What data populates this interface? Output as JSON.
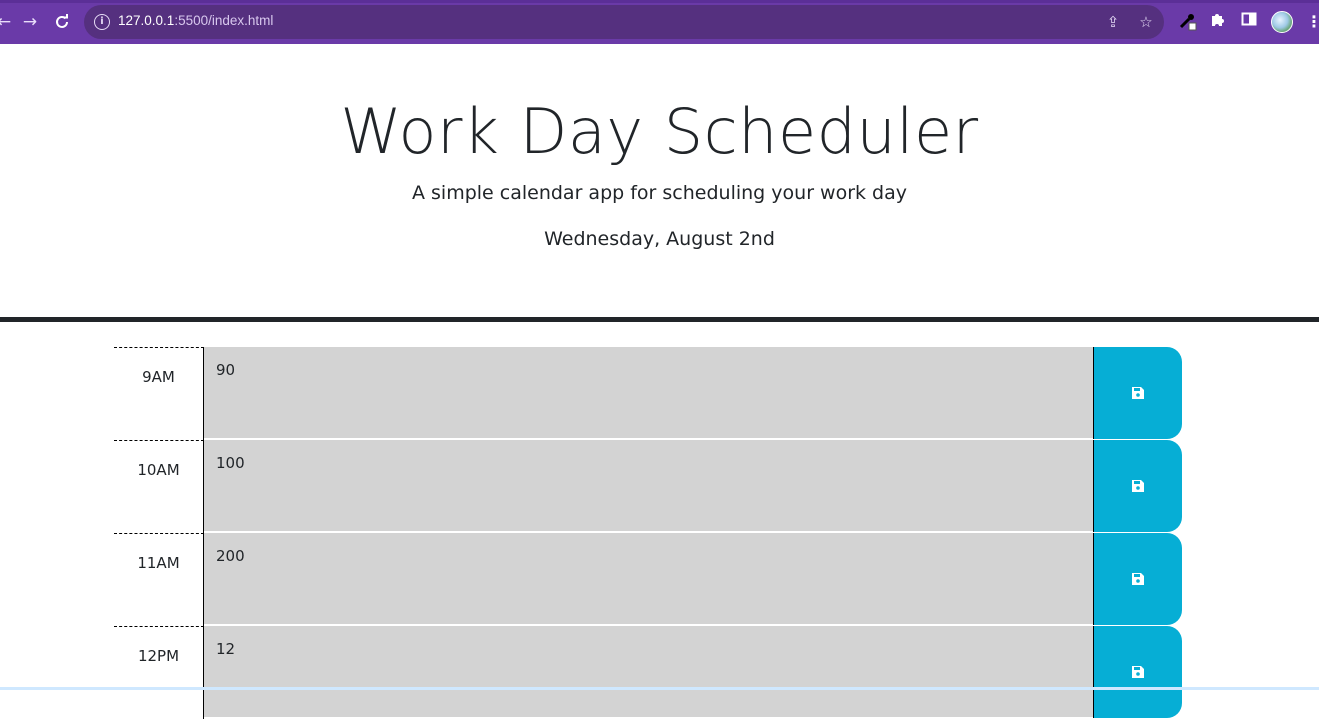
{
  "browser": {
    "back_icon": "arrow-left-icon",
    "forward_icon": "arrow-right-icon",
    "reload_icon": "reload-icon",
    "url_host": "127.0.0.1",
    "url_rest": ":5500/index.html",
    "colors": {
      "toolbar": "#6a3aa8",
      "omnibox": "#55307f"
    }
  },
  "header": {
    "title": "Work Day Scheduler",
    "subtitle": "A simple calendar app for scheduling your work day",
    "current_day": "Wednesday, August 2nd"
  },
  "schedule": {
    "rows": [
      {
        "hour": "9AM",
        "text": "90"
      },
      {
        "hour": "10AM",
        "text": "100"
      },
      {
        "hour": "11AM",
        "text": "200"
      },
      {
        "hour": "12PM",
        "text": "12"
      }
    ],
    "colors": {
      "past": "#d3d3d3",
      "save": "#06aed5"
    }
  }
}
